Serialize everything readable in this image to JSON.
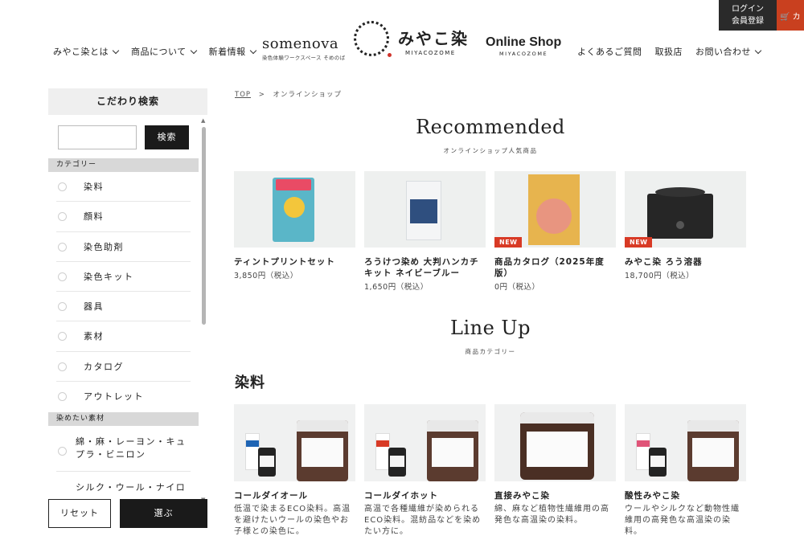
{
  "header": {
    "nav_left": [
      "みやこ染とは",
      "商品について",
      "新着情報"
    ],
    "somenova": {
      "main": "somenova",
      "sub": "染色体験ワークスペース そめのば"
    },
    "logo": {
      "main": "みやこ染",
      "sub": "MIYACOZOME"
    },
    "shop": {
      "main": "Online Shop",
      "sub": "MIYACOZOME"
    },
    "nav_right": [
      "よくあるご質問",
      "取扱店",
      "お問い合わせ"
    ],
    "login_line1": "ログイン",
    "login_line2": "会員登録",
    "cart_label": "カ"
  },
  "sidebar": {
    "title": "こだわり検索",
    "search_placeholder": "",
    "search_button": "検索",
    "category_header": "カテゴリー",
    "categories": [
      "染料",
      "顔料",
      "染色助剤",
      "染色キット",
      "器具",
      "素材",
      "カタログ",
      "アウトレット"
    ],
    "material_header": "染めたい素材",
    "materials": [
      "綿・麻・レーヨン・キュプラ・ビニロン",
      "シルク・ウール・ナイロン・ポリウレタン"
    ],
    "reset_button": "リセット",
    "submit_button": "選ぶ"
  },
  "breadcrumb": {
    "top": "TOP",
    "separator": ">",
    "current": "オンラインショップ"
  },
  "recommended": {
    "title": "Recommended",
    "subtitle": "オンラインショップ人気商品",
    "items": [
      {
        "name": "ティントプリントセット",
        "price": "3,850円（税込）",
        "badge": ""
      },
      {
        "name": "ろうけつ染め 大判ハンカチキット ネイビーブルー",
        "price": "1,650円（税込）",
        "badge": ""
      },
      {
        "name": "商品カタログ（2025年度版）",
        "price": "0円（税込）",
        "badge": "NEW"
      },
      {
        "name": "みやこ染 ろう溶器",
        "price": "18,700円（税込）",
        "badge": "NEW"
      }
    ]
  },
  "lineup": {
    "title": "Line Up",
    "subtitle": "商品カテゴリー",
    "category_title": "染料",
    "items": [
      {
        "name": "コールダイオール",
        "desc": "低温で染まるECO染料。高温を避けたいウールの染色やお子様との染色に。"
      },
      {
        "name": "コールダイホット",
        "desc": "高温で各種繊維が染められるECO染料。混紡品などを染めたい方に。"
      },
      {
        "name": "直接みやこ染",
        "desc": "綿、麻など植物性繊維用の高発色な高温染の染料。"
      },
      {
        "name": "酸性みやこ染",
        "desc": "ウールやシルクなど動物性繊維用の高発色な高温染の染料。"
      }
    ]
  },
  "colors": {
    "accent_red": "#d83a25",
    "dark": "#1a1a1a",
    "cart": "#c9401f"
  }
}
